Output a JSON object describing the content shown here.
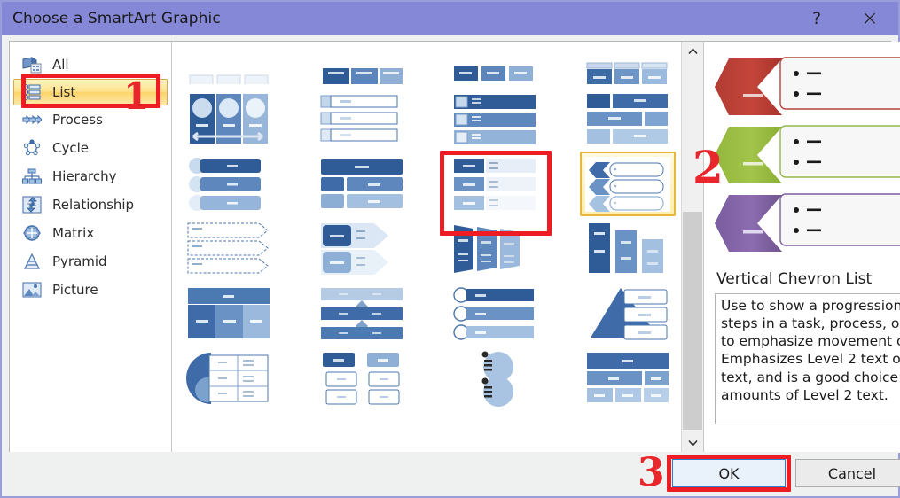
{
  "window": {
    "title": "Choose a SmartArt Graphic",
    "help_icon": "question-mark-icon",
    "help_label": "?",
    "close_icon": "close-icon",
    "close_label": "×",
    "titlebar_color": "#8588d6",
    "dialog_bg": "#eff0f0"
  },
  "sidebar": {
    "items": [
      {
        "label": "All",
        "icon": "all-icon",
        "selected": false
      },
      {
        "label": "List",
        "icon": "list-icon",
        "selected": true
      },
      {
        "label": "Process",
        "icon": "process-icon",
        "selected": false
      },
      {
        "label": "Cycle",
        "icon": "cycle-icon",
        "selected": false
      },
      {
        "label": "Hierarchy",
        "icon": "hierarchy-icon",
        "selected": false
      },
      {
        "label": "Relationship",
        "icon": "relationship-icon",
        "selected": false
      },
      {
        "label": "Matrix",
        "icon": "matrix-icon",
        "selected": false
      },
      {
        "label": "Pyramid",
        "icon": "pyramid-icon",
        "selected": false
      },
      {
        "label": "Picture",
        "icon": "picture-icon",
        "selected": false
      }
    ],
    "selected_index": 1,
    "highlight_color": "#fbd46a"
  },
  "gallery": {
    "columns": 4,
    "selected_index": 11,
    "selected_name": "Vertical Chevron List",
    "selection_color": "#e8b63c",
    "items": [
      {
        "index": 0,
        "layout": "cut-off-row"
      },
      {
        "index": 1,
        "layout": "three-panel-blocks"
      },
      {
        "index": 2,
        "layout": "six-box-grid"
      },
      {
        "index": 3,
        "layout": "three-tab-columns"
      },
      {
        "index": 4,
        "layout": "three-circle-panels-arrow"
      },
      {
        "index": 5,
        "layout": "tab-outline-rows"
      },
      {
        "index": 6,
        "layout": "icon-bar-rows"
      },
      {
        "index": 7,
        "layout": "stacked-block-rows"
      },
      {
        "index": 8,
        "layout": "circle-pill-rows"
      },
      {
        "index": 9,
        "layout": "hierarchy-bars"
      },
      {
        "index": 10,
        "layout": "label-detail-rows"
      },
      {
        "index": 11,
        "layout": "vertical-chevron-list"
      },
      {
        "index": 12,
        "layout": "dashed-arrow-rows"
      },
      {
        "index": 13,
        "layout": "rounded-arrow-rows"
      },
      {
        "index": 14,
        "layout": "chevron-triple"
      },
      {
        "index": 15,
        "layout": "stepped-columns"
      },
      {
        "index": 16,
        "layout": "header-three-columns"
      },
      {
        "index": 17,
        "layout": "down-arrow-bars"
      },
      {
        "index": 18,
        "layout": "circle-bullet-bars"
      },
      {
        "index": 19,
        "layout": "triangle-list"
      },
      {
        "index": 20,
        "layout": "circle-table-list"
      },
      {
        "index": 21,
        "layout": "org-chart-boxes"
      },
      {
        "index": 22,
        "layout": "two-circle-bullets"
      },
      {
        "index": 23,
        "layout": "header-grid-blocks"
      }
    ]
  },
  "scrollbar": {
    "up_icon": "chevron-up-icon",
    "down_icon": "chevron-down-icon",
    "thumb_top_pct": 42,
    "thumb_height_pct": 55
  },
  "preview": {
    "title": "Vertical Chevron List",
    "description": "Use to show a progression or sequential steps in a task, process, or workflow, or to emphasize movement or direction. Emphasizes Level 2 text over Level 1 text, and is a good choice for large amounts of Level 2 text.",
    "chevrons": [
      {
        "color": "#c0392f",
        "bullets": 2
      },
      {
        "color": "#9fbf43",
        "bullets": 2
      },
      {
        "color": "#8465a8",
        "bullets": 2
      }
    ]
  },
  "footer": {
    "ok_label": "OK",
    "cancel_label": "Cancel",
    "ok_focus_color": "#2a7fd4"
  },
  "annotations": [
    {
      "number": "1",
      "target": "sidebar-item-list"
    },
    {
      "number": "2",
      "target": "gallery-item-vertical-chevron-list"
    },
    {
      "number": "3",
      "target": "ok-button"
    }
  ],
  "annotation_numbers": {
    "one": "1",
    "two": "2",
    "three": "3"
  },
  "annotation_color": "#ee1d23"
}
